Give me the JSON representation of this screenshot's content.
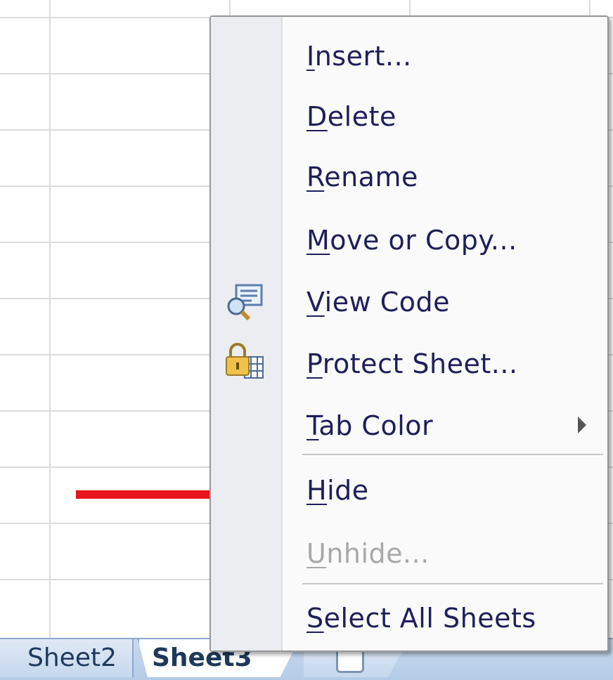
{
  "sheet_tabs": {
    "items": [
      {
        "label": "Sheet2",
        "active": false
      },
      {
        "label": "Sheet3",
        "active": true
      }
    ],
    "insert_sheet_icon": "insert-worksheet-icon"
  },
  "context_menu": {
    "items": [
      {
        "pre": "",
        "key": "I",
        "post": "nsert...",
        "enabled": true
      },
      {
        "pre": "",
        "key": "D",
        "post": "elete",
        "enabled": true
      },
      {
        "pre": "",
        "key": "R",
        "post": "ename",
        "enabled": true
      },
      {
        "pre": "",
        "key": "M",
        "post": "ove or Copy...",
        "enabled": true
      },
      {
        "pre": "",
        "key": "V",
        "post": "iew Code",
        "enabled": true,
        "icon": "view-code-icon"
      },
      {
        "pre": "",
        "key": "P",
        "post": "rotect Sheet...",
        "enabled": true,
        "icon": "protect-sheet-lock-icon"
      },
      {
        "pre": "",
        "key": "T",
        "post": "ab Color",
        "enabled": true,
        "submenu": true
      },
      {
        "pre": "",
        "key": "H",
        "post": "ide",
        "enabled": true
      },
      {
        "pre": "",
        "key": "U",
        "post": "nhide...",
        "enabled": false
      },
      {
        "pre": "",
        "key": "S",
        "post": "elect All Sheets",
        "enabled": true
      }
    ]
  },
  "annotation": {
    "icon": "red-arrow-pointer",
    "color": "#e8141b",
    "target": "Hide"
  },
  "colors": {
    "menu_text": "#1e1e5a",
    "disabled_text": "#a8a8a8",
    "tab_bar": "#b4cbe7"
  }
}
